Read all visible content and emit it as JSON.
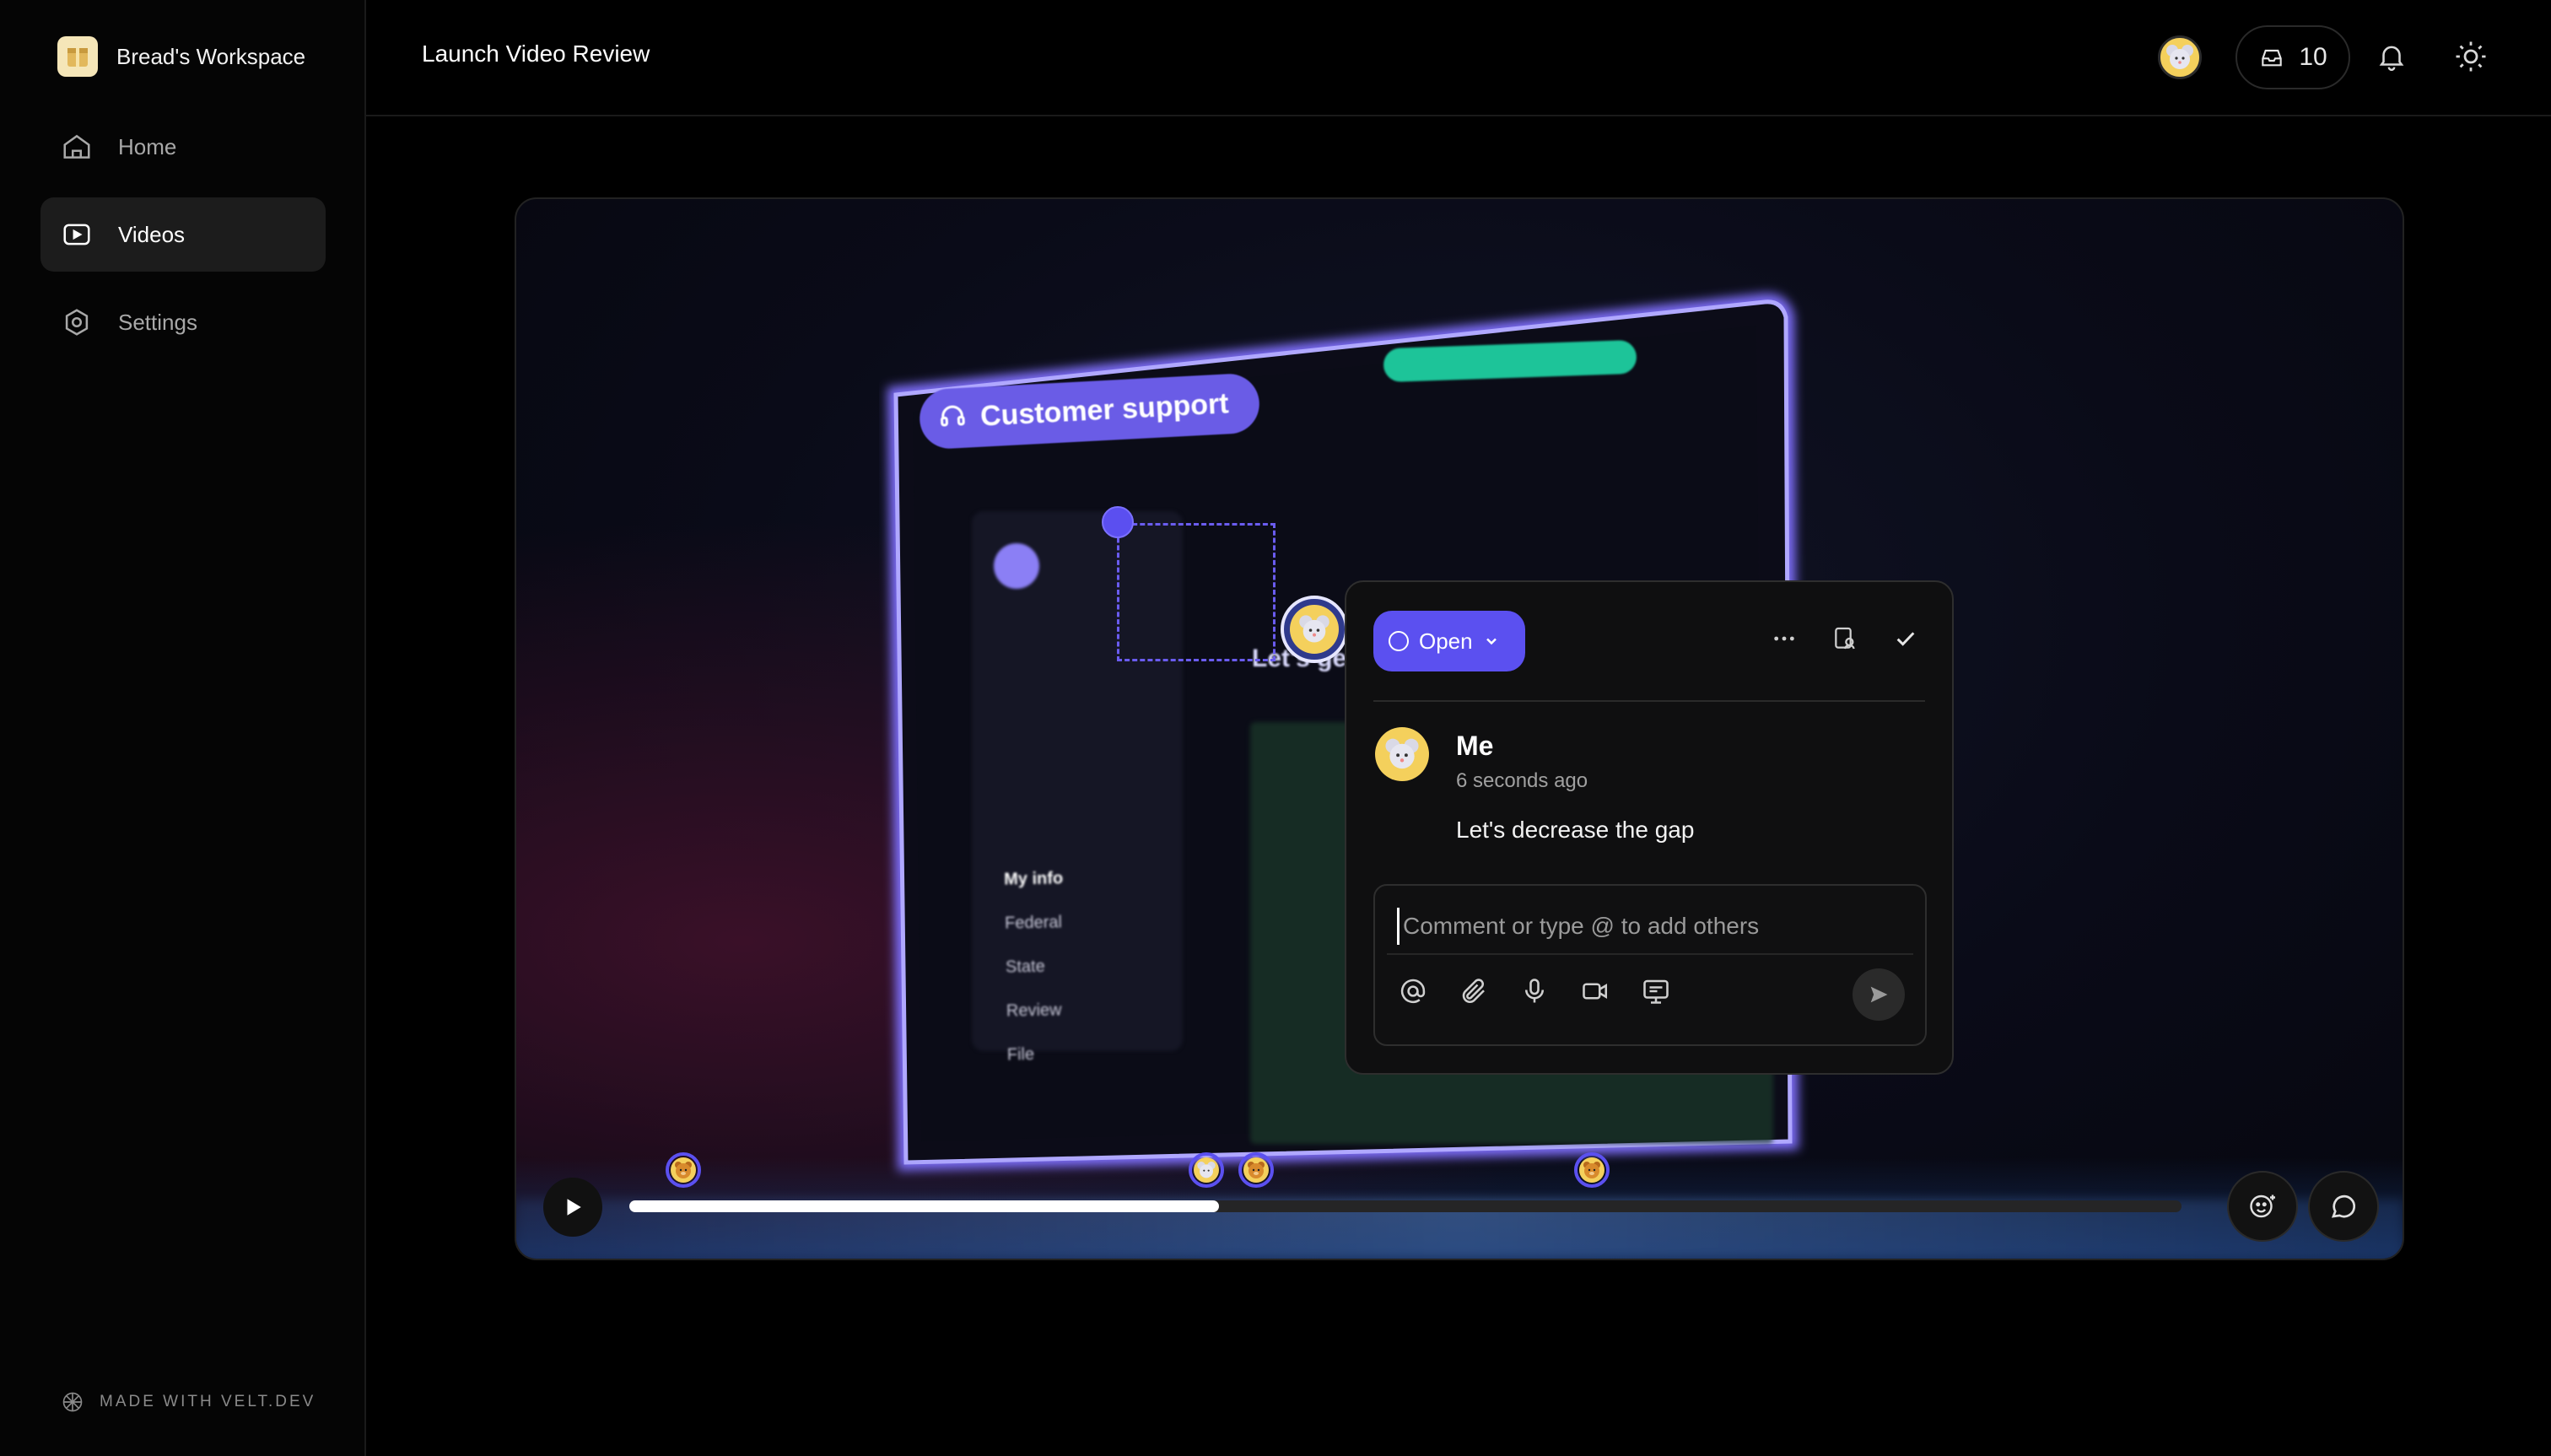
{
  "workspace": {
    "name": "Bread's Workspace",
    "logo_icon": "package-icon"
  },
  "sidebar": {
    "items": [
      {
        "label": "Home",
        "icon": "home-icon",
        "active": false
      },
      {
        "label": "Videos",
        "icon": "video-icon",
        "active": true
      },
      {
        "label": "Settings",
        "icon": "settings-icon",
        "active": false
      }
    ],
    "footer": "MADE WITH VELT.DEV"
  },
  "header": {
    "title": "Launch Video Review",
    "inbox_count": "10"
  },
  "video": {
    "overlay_text": {
      "customer_support": "Customer support",
      "lets": "Let's ge"
    },
    "menu_lines": [
      "My info",
      "Federal",
      "State",
      "Review",
      "File"
    ],
    "progress": 0.38
  },
  "comment_dialog": {
    "status_label": "Open",
    "author": "Me",
    "time": "6 seconds ago",
    "body": "Let's decrease the gap",
    "input_placeholder": "Comment or type @ to add others"
  },
  "timeline_markers": [
    {
      "position": 0.035,
      "type": "bear"
    },
    {
      "position": 0.372,
      "type": "mouse"
    },
    {
      "position": 0.404,
      "type": "bear"
    },
    {
      "position": 0.62,
      "type": "bear"
    }
  ],
  "colors": {
    "accent": "#5b50f0",
    "avatar_yellow": "#f4d05c",
    "background": "#000000"
  }
}
